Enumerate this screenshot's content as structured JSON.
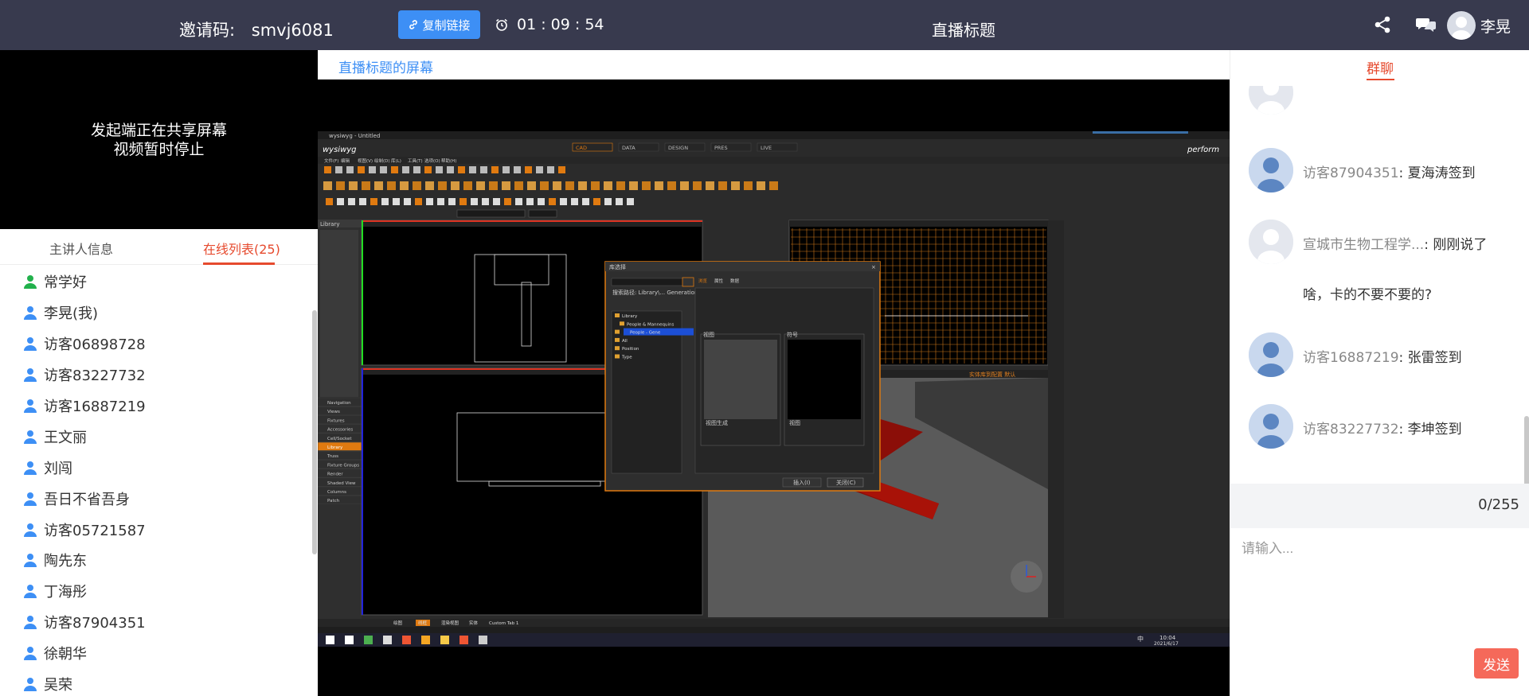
{
  "topbar": {
    "invite_label": "邀请码:",
    "invite_code": "smvj6081",
    "copy_link_label": "复制链接",
    "timer": "01 : 09 : 54",
    "live_title": "直播标题",
    "user_name": "李晃",
    "icons": [
      "share-icon",
      "chat-icon",
      "avatar",
      "link-icon",
      "alarm-clock-icon"
    ]
  },
  "video": {
    "paused_line1": "发起端正在共享屏幕",
    "paused_line2": "视频暂时停止"
  },
  "left_tabs": {
    "host_info": "主讲人信息",
    "online_list": "在线列表(25)"
  },
  "online_users": [
    "常学好",
    "李晃(我)",
    "访客06898728",
    "访客83227732",
    "访客16887219",
    "王文丽",
    "刘闯",
    "吾日不省吾身",
    "访客05721587",
    "陶先东",
    "丁海彤",
    "访客87904351",
    "徐朝华",
    "吴荣"
  ],
  "colors": {
    "topbar_bg": "#383a4e",
    "accent_blue": "#3d8ff5",
    "accent_red": "#e64a2e",
    "send_button": "#f5695a",
    "online_green": "#22b14c",
    "online_blue": "#3d8ff5"
  },
  "screen": {
    "title": "直播标题的屏幕"
  },
  "chat": {
    "tab_label": "群聊",
    "messages": [
      {
        "name": "访客87904351",
        "sep": ":",
        "text": "夏海涛签到",
        "extra": ""
      },
      {
        "name": "宣城市生物工程学...",
        "sep": ":",
        "text": "刚刚说了",
        "extra": "啥，卡的不要不要的?"
      },
      {
        "name": "访客16887219",
        "sep": ":",
        "text": "张雷签到",
        "extra": ""
      },
      {
        "name": "访客83227732",
        "sep": ":",
        "text": "李坤签到",
        "extra": ""
      }
    ],
    "counter": "0/255",
    "input_placeholder": "请输入...",
    "send_label": "发送"
  },
  "shared_screen": {
    "window_title": "wysiwyg - Untitled",
    "app_logo": "wysiwyg",
    "brand": "perform",
    "modes": [
      "CAD",
      "DATA",
      "DESIGN",
      "PRES",
      "LIVE"
    ],
    "menu": [
      "文件(F)",
      "编辑",
      "视图(V)",
      "绘制(D)",
      "库(L)",
      "工具(T)",
      "选项(O)",
      "帮助(H)"
    ],
    "sidebar_header": "Library",
    "sidebar_items": [
      "Navigation",
      "Views",
      "Fixtures",
      "Accessories",
      "Cell/Socket",
      "Library",
      "Truss",
      "Fixture Groups",
      "Render",
      "Shaded View",
      "Columns",
      "Patch"
    ],
    "dialog_title": "库选择",
    "dialog_tabs": [
      "浏览",
      "属性",
      "数据"
    ],
    "dialog_tree": [
      "Library",
      "People & Mannequins",
      "People - Gene",
      "All",
      "Position",
      "Type"
    ],
    "dialog_path": "搜索路径: Library\\... Generation 2",
    "dialog_preview1_label": "视图",
    "dialog_preview2_label": "符号",
    "dialog_sub1": "视图生成",
    "dialog_sub2": "视图",
    "dialog_btn_insert": "插入(I)",
    "dialog_btn_close": "关闭(C)",
    "bottom_tabs": [
      "绘图",
      "线框",
      "渲染视图",
      "实体",
      "Custom Tab 1"
    ],
    "render_label": "实体库到配置 默认",
    "taskbar_time": "10:04",
    "taskbar_date": "2021/6/17",
    "taskbar_ime": "中"
  }
}
